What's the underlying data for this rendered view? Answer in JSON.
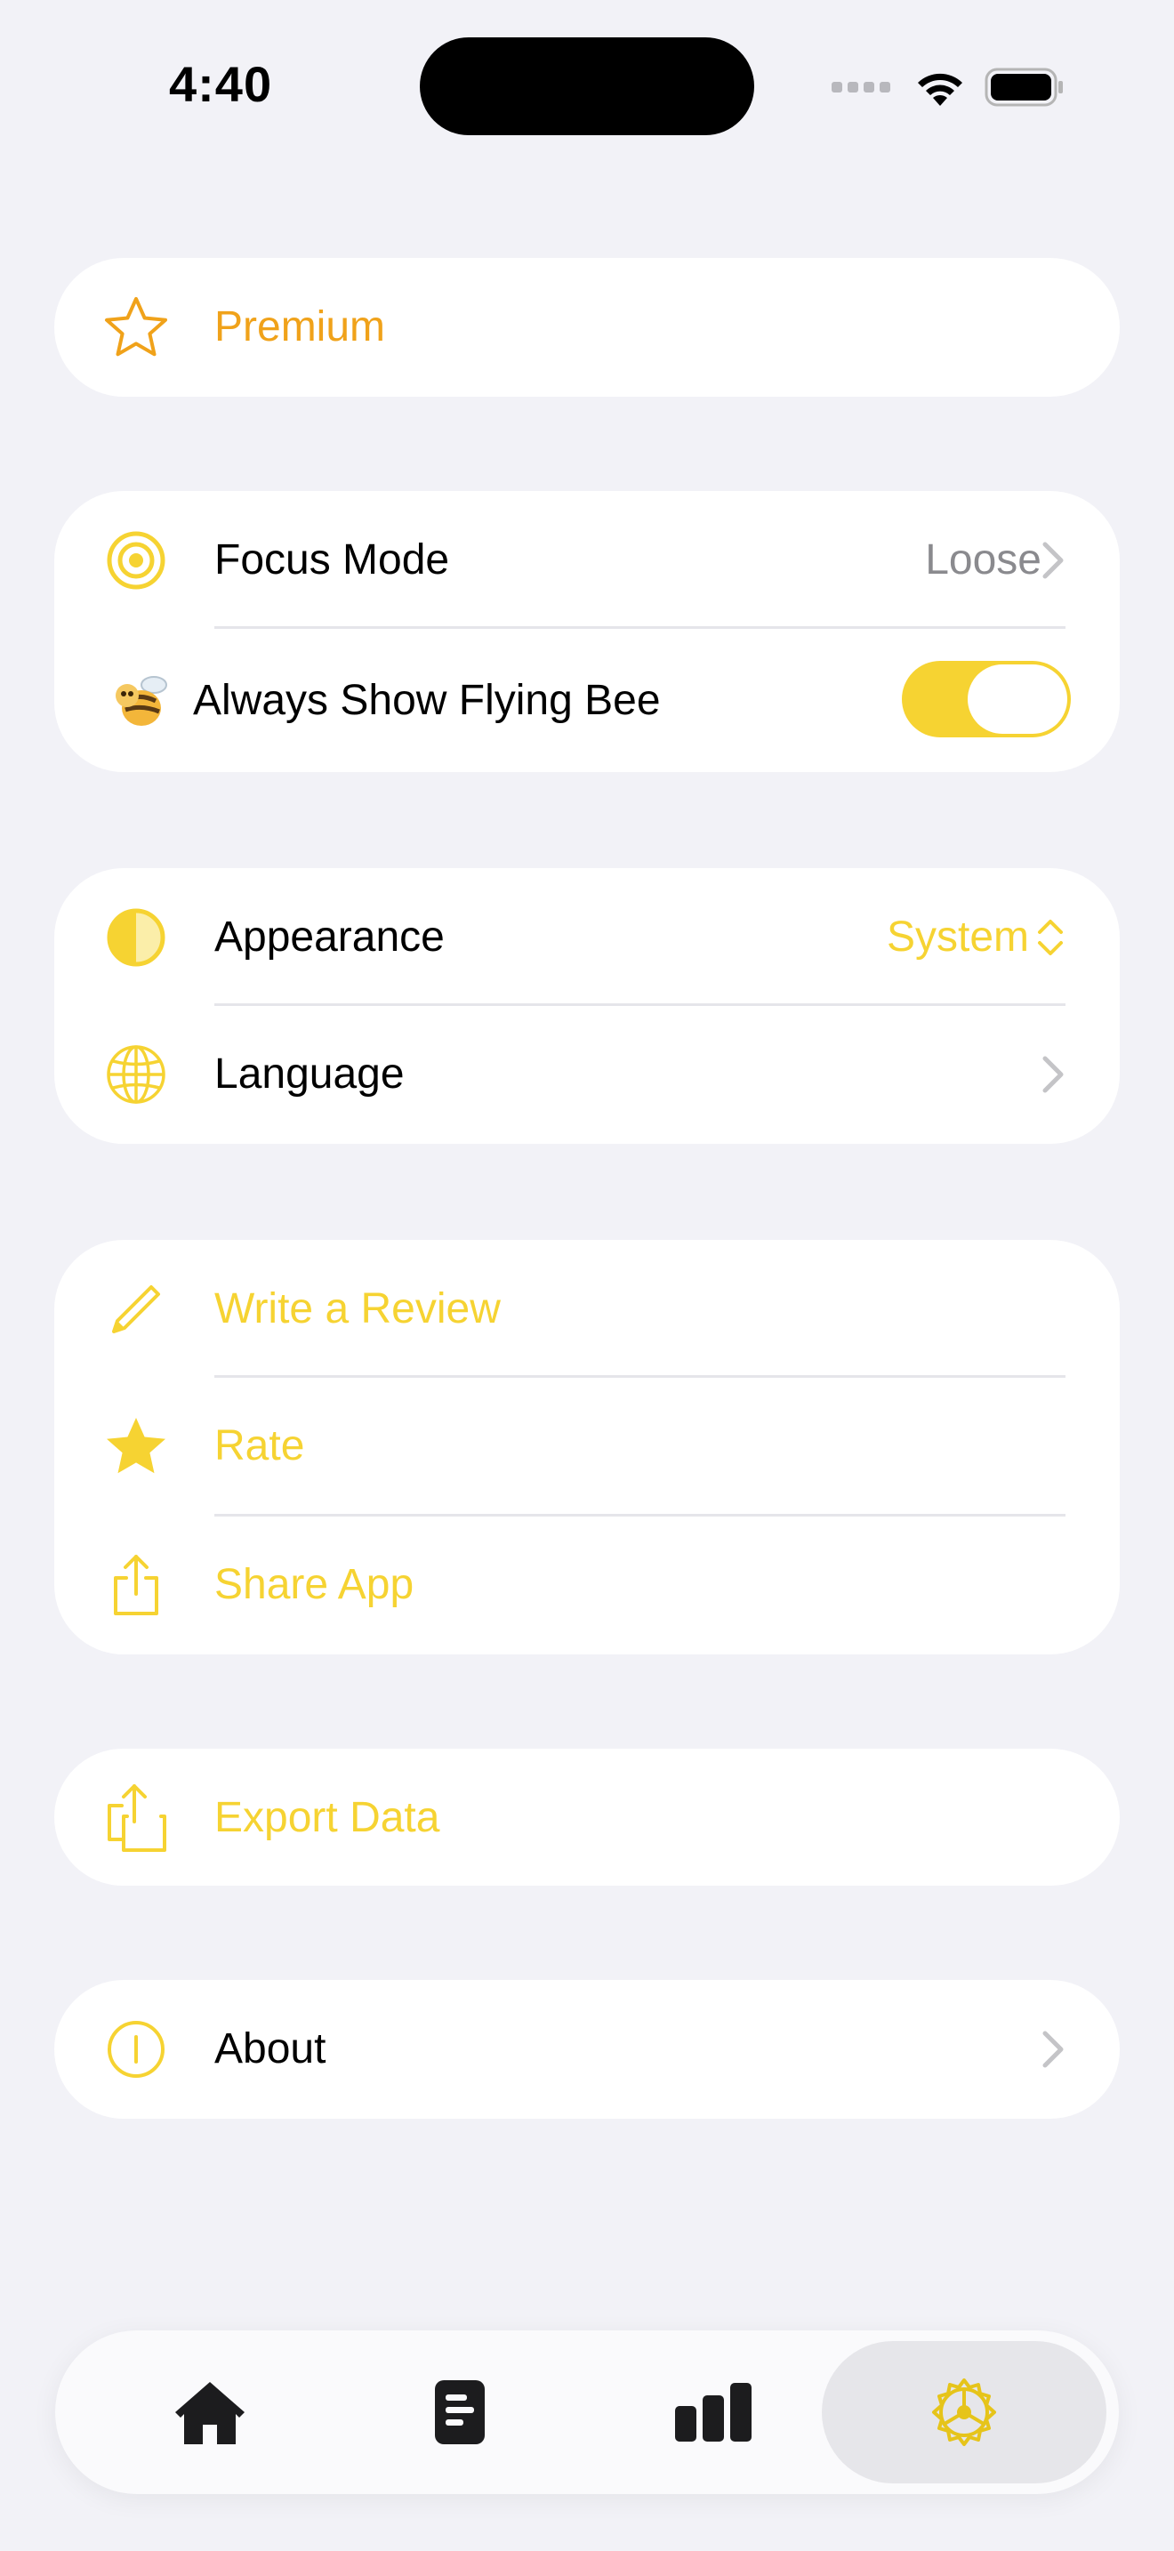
{
  "status_bar": {
    "time": "4:40"
  },
  "premium": {
    "label": "Premium"
  },
  "focus_mode": {
    "label": "Focus Mode",
    "value": "Loose"
  },
  "flying_bee": {
    "label": "Always Show Flying Bee",
    "enabled": true
  },
  "appearance": {
    "label": "Appearance",
    "value": "System"
  },
  "language": {
    "label": "Language"
  },
  "review": {
    "label": "Write a Review"
  },
  "rate": {
    "label": "Rate"
  },
  "share": {
    "label": "Share App"
  },
  "export": {
    "label": "Export Data"
  },
  "about": {
    "label": "About"
  },
  "tab_bar": {
    "tabs": [
      {
        "icon": "home-icon"
      },
      {
        "icon": "document-icon"
      },
      {
        "icon": "chart-icon"
      },
      {
        "icon": "settings-icon",
        "active": true
      }
    ]
  },
  "colors": {
    "accent": "#f6d332",
    "premium": "#f0a21a",
    "background": "#f2f2f7"
  }
}
